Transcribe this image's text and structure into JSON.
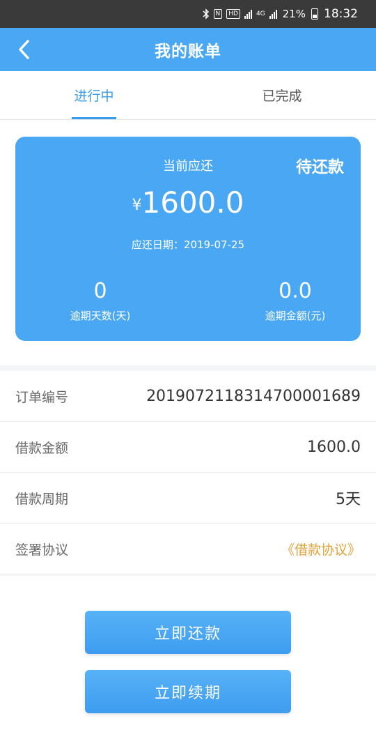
{
  "status_bar": {
    "battery": "21%",
    "time": "18:32",
    "icons": [
      "bluetooth-icon",
      "nfc-icon",
      "hd-icon",
      "signal-icon",
      "4g-icon",
      "signal-icon",
      "battery-icon"
    ]
  },
  "nav": {
    "title": "我的账单",
    "back_icon": "chevron-left-icon"
  },
  "tabs": [
    {
      "label": "进行中",
      "active": true
    },
    {
      "label": "已完成",
      "active": false
    }
  ],
  "bill_card": {
    "label": "当前应还",
    "status": "待还款",
    "currency": "¥",
    "amount": "1600.0",
    "due_label": "应还日期：",
    "due_date": "2019-07-25",
    "overdue_days_value": "0",
    "overdue_days_label": "逾期天数(天)",
    "overdue_amount_value": "0.0",
    "overdue_amount_label": "逾期金额(元)"
  },
  "details": [
    {
      "label": "订单编号",
      "value": "20190721183147000016​89"
    },
    {
      "label": "借款金额",
      "value": "1600.0"
    },
    {
      "label": "借款周期",
      "value": "5天"
    },
    {
      "label": "签署协议",
      "value": "《借款协议》"
    }
  ],
  "buttons": {
    "pay": "立即还款",
    "renew": "立即续期"
  },
  "colors": {
    "primary": "#4aa7f3",
    "tab_active": "#3a9be8",
    "link": "#e0a43a"
  }
}
